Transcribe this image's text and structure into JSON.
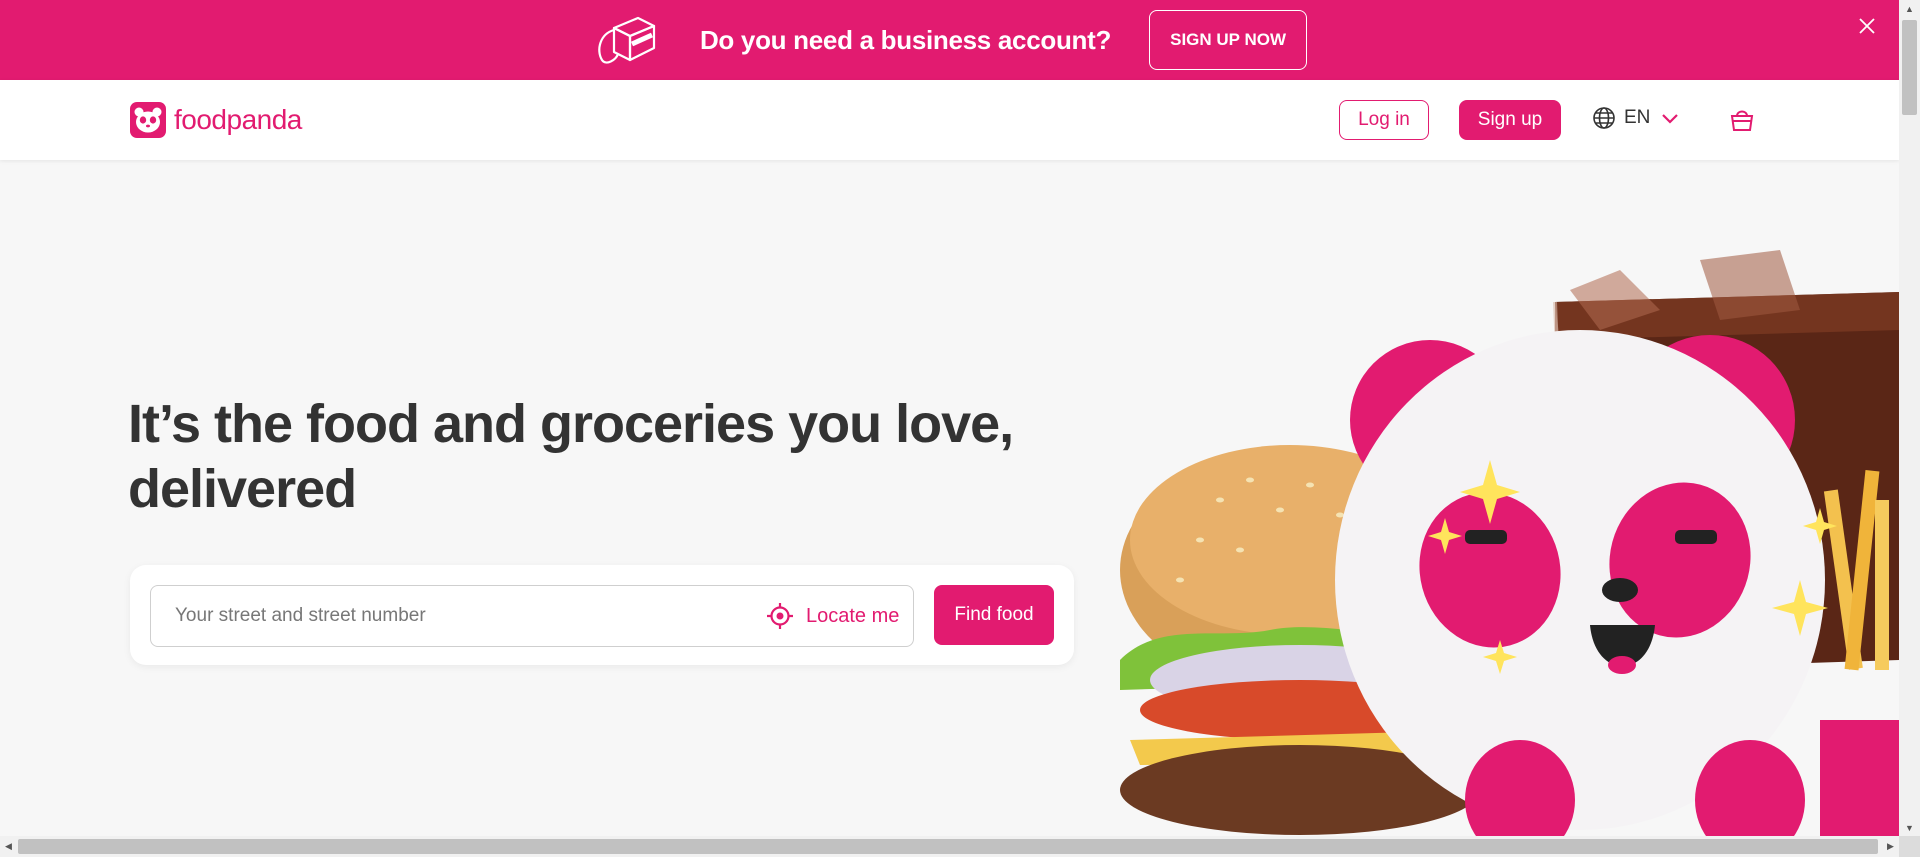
{
  "promo": {
    "text": "Do you need a business account?",
    "button_label": "SIGN UP NOW",
    "icon": "delivery-bag-icon",
    "close_icon": "close-icon"
  },
  "header": {
    "brand": "foodpanda",
    "logo_icon": "panda-logo-icon",
    "login_label": "Log in",
    "signup_label": "Sign up",
    "language": "EN",
    "language_icon": "globe-icon",
    "dropdown_icon": "chevron-down-icon",
    "cart_icon": "shopping-bag-icon"
  },
  "hero": {
    "title": "It’s the food and groceries you love, delivered",
    "search_placeholder": "Your street and street number",
    "locate_label": "Locate me",
    "locate_icon": "crosshair-icon",
    "find_label": "Find food",
    "illustration": "panda-burger-drink-illustration"
  },
  "colors": {
    "brand": "#e21b70",
    "background": "#f7f7f7",
    "text": "#333333"
  }
}
